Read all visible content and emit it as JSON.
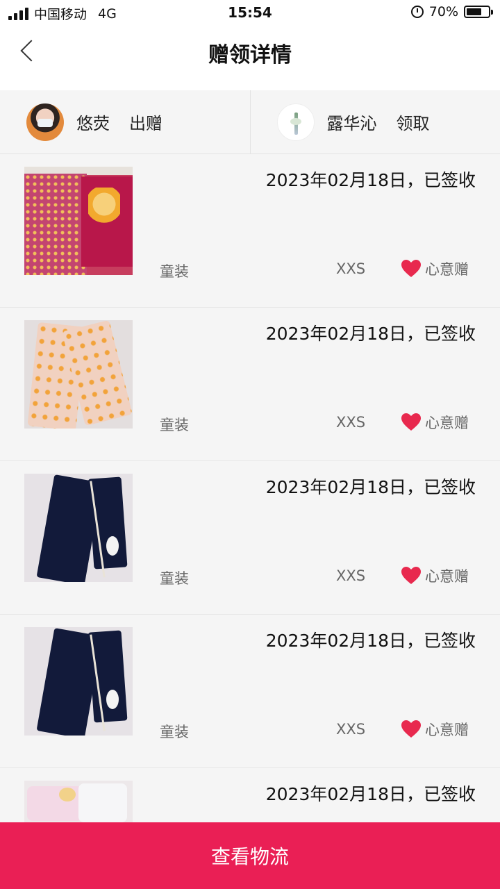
{
  "status_bar": {
    "carrier": "中国移动",
    "network": "4G",
    "time": "15:54",
    "battery_percent": "70%",
    "battery_level": 0.7
  },
  "header": {
    "title": "赠领详情",
    "back_icon": "chevron-left-icon"
  },
  "giver": {
    "name": "悠荧",
    "action": "出赠"
  },
  "receiver": {
    "name": "露华沁",
    "action": "领取"
  },
  "items": [
    {
      "date_status": "2023年02月18日，已签收",
      "category": "童装",
      "size": "XXS",
      "gift_type": "心意赠"
    },
    {
      "date_status": "2023年02月18日，已签收",
      "category": "童装",
      "size": "XXS",
      "gift_type": "心意赠"
    },
    {
      "date_status": "2023年02月18日，已签收",
      "category": "童装",
      "size": "XXS",
      "gift_type": "心意赠"
    },
    {
      "date_status": "2023年02月18日，已签收",
      "category": "童装",
      "size": "XXS",
      "gift_type": "心意赠"
    },
    {
      "date_status": "2023年02月18日，已签收"
    }
  ],
  "footer": {
    "button_label": "查看物流"
  },
  "colors": {
    "accent": "#ea1f55",
    "heart": "#e8294e",
    "background": "#f5f5f5"
  }
}
